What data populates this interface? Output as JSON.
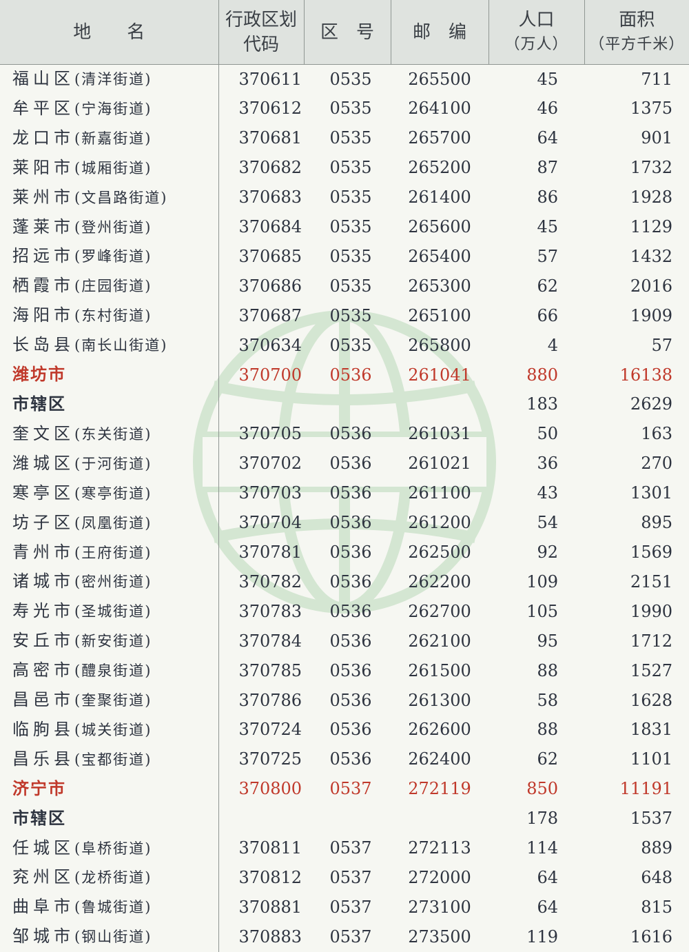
{
  "header": {
    "name": "地　　名",
    "code": [
      "行政区划",
      "代码"
    ],
    "area_code": "区　号",
    "postcode": "邮　编",
    "population": [
      "人口",
      "（万人）"
    ],
    "area": [
      "面积",
      "（平方千米）"
    ]
  },
  "rows": [
    {
      "kind": "county",
      "name": "福山区",
      "street": "(清洋街道)",
      "code": "370611",
      "area_code": "0535",
      "postcode": "265500",
      "population": "45",
      "area": "711"
    },
    {
      "kind": "county",
      "name": "牟平区",
      "street": "(宁海街道)",
      "code": "370612",
      "area_code": "0535",
      "postcode": "264100",
      "population": "46",
      "area": "1375"
    },
    {
      "kind": "county",
      "name": "龙口市",
      "street": "(新嘉街道)",
      "code": "370681",
      "area_code": "0535",
      "postcode": "265700",
      "population": "64",
      "area": "901"
    },
    {
      "kind": "county",
      "name": "莱阳市",
      "street": "(城厢街道)",
      "code": "370682",
      "area_code": "0535",
      "postcode": "265200",
      "population": "87",
      "area": "1732"
    },
    {
      "kind": "county",
      "name": "莱州市",
      "street": "(文昌路街道)",
      "code": "370683",
      "area_code": "0535",
      "postcode": "261400",
      "population": "86",
      "area": "1928"
    },
    {
      "kind": "county",
      "name": "蓬莱市",
      "street": "(登州街道)",
      "code": "370684",
      "area_code": "0535",
      "postcode": "265600",
      "population": "45",
      "area": "1129"
    },
    {
      "kind": "county",
      "name": "招远市",
      "street": "(罗峰街道)",
      "code": "370685",
      "area_code": "0535",
      "postcode": "265400",
      "population": "57",
      "area": "1432"
    },
    {
      "kind": "county",
      "name": "栖霞市",
      "street": "(庄园街道)",
      "code": "370686",
      "area_code": "0535",
      "postcode": "265300",
      "population": "62",
      "area": "2016"
    },
    {
      "kind": "county",
      "name": "海阳市",
      "street": "(东村街道)",
      "code": "370687",
      "area_code": "0535",
      "postcode": "265100",
      "population": "66",
      "area": "1909"
    },
    {
      "kind": "county",
      "name": "长岛县",
      "street": "(南长山街道)",
      "code": "370634",
      "area_code": "0535",
      "postcode": "265800",
      "population": "4",
      "area": "57"
    },
    {
      "kind": "city",
      "name": "潍坊市",
      "street": "",
      "code": "370700",
      "area_code": "0536",
      "postcode": "261041",
      "population": "880",
      "area": "16138"
    },
    {
      "kind": "district",
      "name": "市辖区",
      "street": "",
      "code": "",
      "area_code": "",
      "postcode": "",
      "population": "183",
      "area": "2629"
    },
    {
      "kind": "county",
      "name": "奎文区",
      "street": "(东关街道)",
      "code": "370705",
      "area_code": "0536",
      "postcode": "261031",
      "population": "50",
      "area": "163"
    },
    {
      "kind": "county",
      "name": "潍城区",
      "street": "(于河街道)",
      "code": "370702",
      "area_code": "0536",
      "postcode": "261021",
      "population": "36",
      "area": "270"
    },
    {
      "kind": "county",
      "name": "寒亭区",
      "street": "(寒亭街道)",
      "code": "370703",
      "area_code": "0536",
      "postcode": "261100",
      "population": "43",
      "area": "1301"
    },
    {
      "kind": "county",
      "name": "坊子区",
      "street": "(凤凰街道)",
      "code": "370704",
      "area_code": "0536",
      "postcode": "261200",
      "population": "54",
      "area": "895"
    },
    {
      "kind": "county",
      "name": "青州市",
      "street": "(王府街道)",
      "code": "370781",
      "area_code": "0536",
      "postcode": "262500",
      "population": "92",
      "area": "1569"
    },
    {
      "kind": "county",
      "name": "诸城市",
      "street": "(密州街道)",
      "code": "370782",
      "area_code": "0536",
      "postcode": "262200",
      "population": "109",
      "area": "2151"
    },
    {
      "kind": "county",
      "name": "寿光市",
      "street": "(圣城街道)",
      "code": "370783",
      "area_code": "0536",
      "postcode": "262700",
      "population": "105",
      "area": "1990"
    },
    {
      "kind": "county",
      "name": "安丘市",
      "street": "(新安街道)",
      "code": "370784",
      "area_code": "0536",
      "postcode": "262100",
      "population": "95",
      "area": "1712"
    },
    {
      "kind": "county",
      "name": "高密市",
      "street": "(醴泉街道)",
      "code": "370785",
      "area_code": "0536",
      "postcode": "261500",
      "population": "88",
      "area": "1527"
    },
    {
      "kind": "county",
      "name": "昌邑市",
      "street": "(奎聚街道)",
      "code": "370786",
      "area_code": "0536",
      "postcode": "261300",
      "population": "58",
      "area": "1628"
    },
    {
      "kind": "county",
      "name": "临朐县",
      "street": "(城关街道)",
      "code": "370724",
      "area_code": "0536",
      "postcode": "262600",
      "population": "88",
      "area": "1831"
    },
    {
      "kind": "county",
      "name": "昌乐县",
      "street": "(宝都街道)",
      "code": "370725",
      "area_code": "0536",
      "postcode": "262400",
      "population": "62",
      "area": "1101"
    },
    {
      "kind": "city",
      "name": "济宁市",
      "street": "",
      "code": "370800",
      "area_code": "0537",
      "postcode": "272119",
      "population": "850",
      "area": "11191"
    },
    {
      "kind": "district",
      "name": "市辖区",
      "street": "",
      "code": "",
      "area_code": "",
      "postcode": "",
      "population": "178",
      "area": "1537"
    },
    {
      "kind": "county",
      "name": "任城区",
      "street": "(阜桥街道)",
      "code": "370811",
      "area_code": "0537",
      "postcode": "272113",
      "population": "114",
      "area": "889"
    },
    {
      "kind": "county",
      "name": "兖州区",
      "street": "(龙桥街道)",
      "code": "370812",
      "area_code": "0537",
      "postcode": "272000",
      "population": "64",
      "area": "648"
    },
    {
      "kind": "county",
      "name": "曲阜市",
      "street": "(鲁城街道)",
      "code": "370881",
      "area_code": "0537",
      "postcode": "273100",
      "population": "64",
      "area": "815"
    },
    {
      "kind": "county",
      "name": "邹城市",
      "street": "(钢山街道)",
      "code": "370883",
      "area_code": "0537",
      "postcode": "273500",
      "population": "119",
      "area": "1616"
    }
  ]
}
